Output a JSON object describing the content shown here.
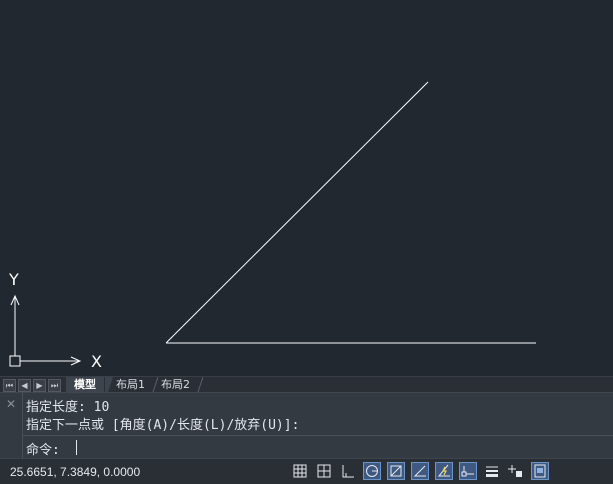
{
  "ucs": {
    "x_label": "X",
    "y_label": "Y"
  },
  "layout_tabs": {
    "nav": [
      "first-icon",
      "prev-icon",
      "next-icon",
      "last-icon"
    ],
    "tabs": [
      {
        "label": "模型",
        "active": true
      },
      {
        "label": "布局1",
        "active": false
      },
      {
        "label": "布局2",
        "active": false
      }
    ]
  },
  "command": {
    "close_glyph": "✕",
    "history": [
      "指定长度: 10",
      "指定下一点或 [角度(A)/长度(L)/放弃(U)]:"
    ],
    "prompt": "命令:"
  },
  "status_bar": {
    "coordinates": "25.6651, 7.3849, 0.0000",
    "toggles": [
      {
        "name": "grid-icon",
        "on": false
      },
      {
        "name": "snap-grid-icon",
        "on": false
      },
      {
        "name": "ortho-icon",
        "on": false
      },
      {
        "name": "polar-icon",
        "on": true
      },
      {
        "name": "osnap-icon",
        "on": true
      },
      {
        "name": "otrack-icon",
        "on": true
      },
      {
        "name": "dynamic-input-icon",
        "on": true
      },
      {
        "name": "dynamic-ucs-icon",
        "on": true
      },
      {
        "name": "lineweight-icon",
        "on": false
      },
      {
        "name": "selection-cycling-icon",
        "on": false
      },
      {
        "name": "annotation-monitor-icon",
        "on": true
      }
    ]
  },
  "colors": {
    "canvas": "#212830",
    "line": "#ffffff",
    "toggle_on": "#3e5a82"
  }
}
